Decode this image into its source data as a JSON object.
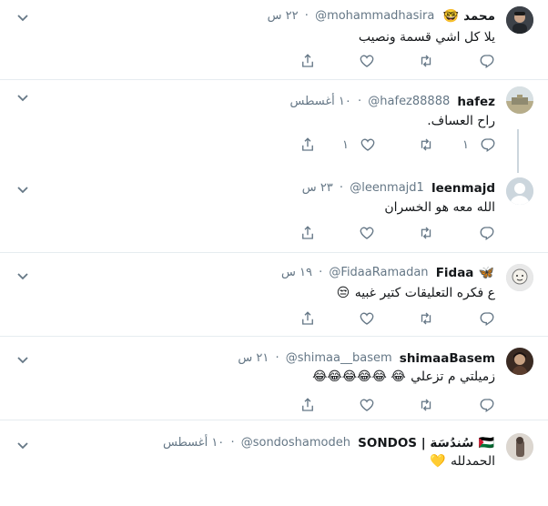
{
  "tweets": [
    {
      "name": "محمد",
      "emoji": "🤓",
      "handle": "@mohammadhasira",
      "time": "٢٢ س",
      "text": "يلا كل اشي قسمة ونصيب",
      "text_emoji": "",
      "reply_count": "",
      "like_count": ""
    },
    {
      "name": "hafez",
      "emoji": "",
      "handle": "@hafez88888",
      "time": "١٠ أغسطس",
      "text": "راح العساف.",
      "text_emoji": "",
      "reply_count": "١",
      "like_count": "١"
    },
    {
      "name": "leenmajd",
      "emoji": "",
      "handle": "@leenmajd1",
      "time": "٢٣ س",
      "text": "الله معه هو الخسران",
      "text_emoji": "",
      "reply_count": "",
      "like_count": ""
    },
    {
      "name": "Fidaa",
      "emoji": "🦋",
      "handle": "@FidaaRamadan",
      "time": "١٩ س",
      "text": "ع فكره التعليقات كتير غبيه",
      "text_emoji": "😒",
      "reply_count": "",
      "like_count": ""
    },
    {
      "name": "shimaaBasem",
      "emoji": "",
      "handle": "@shimaa__basem",
      "time": "٢١ س",
      "text": "زميلتي م تزعلي",
      "text_emoji": "😂 😂😂😂😂😂",
      "reply_count": "",
      "like_count": ""
    },
    {
      "name": "سُندُسَة | SONDOS",
      "emoji": "🇵🇸",
      "handle": "@sondoshamodeh",
      "time": "١٠ أغسطس",
      "text": "الحمدلله",
      "text_emoji": "💛",
      "reply_count": "",
      "like_count": ""
    }
  ],
  "separator_dot": "·",
  "colors": {
    "text": "#14171a",
    "secondary": "#657786",
    "border": "#e6ecf0",
    "thread": "#ccd6dd"
  },
  "icons": [
    "chevron-down-icon",
    "reply-icon",
    "retweet-icon",
    "like-icon",
    "share-icon"
  ]
}
